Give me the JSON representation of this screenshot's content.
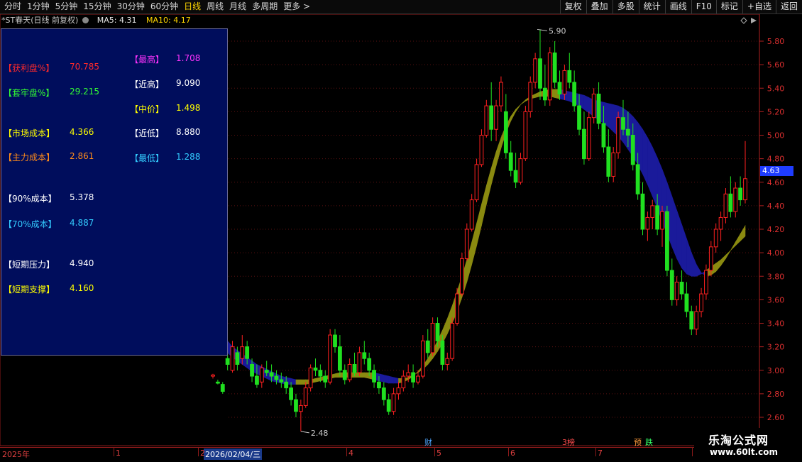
{
  "toolbar": {
    "periods": [
      "分时",
      "1分钟",
      "5分钟",
      "15分钟",
      "30分钟",
      "60分钟",
      "日线",
      "周线",
      "月线",
      "多周期",
      "更多 >"
    ],
    "active_period": "日线",
    "tools": [
      "复权",
      "叠加",
      "多股",
      "统计",
      "画线",
      "F10",
      "标记",
      "+自选",
      "返回"
    ]
  },
  "infobar": {
    "title": "*ST春天(日线 前复权)",
    "ma5": "MA5: 4.31",
    "ma10": "MA10: 4.17"
  },
  "panel": {
    "left": [
      {
        "label": "【获利盘%】",
        "value": "70.785",
        "color": "#ff2a2a"
      },
      {
        "label": "【套牢盘%】",
        "value": "29.215",
        "color": "#33ff33"
      },
      {
        "label": "【市场成本】",
        "value": "4.366",
        "color": "#ffff00"
      },
      {
        "label": "【主力成本】",
        "value": "2.861",
        "color": "#ff8c1a"
      },
      {
        "label": "【90%成本】",
        "value": "5.378",
        "color": "#ffffff"
      },
      {
        "label": "【70%成本】",
        "value": "4.887",
        "color": "#33ccff"
      },
      {
        "label": "【短期压力】",
        "value": "4.940",
        "color": "#ffffff"
      },
      {
        "label": "【短期支撑】",
        "value": "4.160",
        "color": "#ffff00"
      }
    ],
    "right": [
      {
        "label": "【最高】",
        "value": "1.708",
        "color": "#ff33ff"
      },
      {
        "label": "【近高】",
        "value": "9.090",
        "color": "#ffffff"
      },
      {
        "label": "【中价】",
        "value": "1.498",
        "color": "#ffff00"
      },
      {
        "label": "【近低】",
        "value": "8.880",
        "color": "#ffffff"
      },
      {
        "label": "【最低】",
        "value": "1.288",
        "color": "#33ccff"
      }
    ]
  },
  "price_axis": {
    "labels": [
      "5.80",
      "5.60",
      "5.40",
      "5.20",
      "5.00",
      "4.80",
      "4.60",
      "4.40",
      "4.20",
      "4.00",
      "3.80",
      "3.60",
      "3.40",
      "3.20",
      "3.00",
      "2.80",
      "2.60"
    ],
    "current": "4.63"
  },
  "annotations": {
    "high": "5.90",
    "low": "2.48"
  },
  "time_axis": {
    "year": "2025年",
    "cursor_date": "2026/02/04/三",
    "months": [
      "1",
      "2",
      "4",
      "5",
      "6",
      "7",
      "8"
    ]
  },
  "events": [
    {
      "text": "财",
      "color": "#4da6ff"
    },
    {
      "text": "3榜",
      "color": "#ff4d4d"
    },
    {
      "text": "预",
      "color": "#ff9a3a"
    },
    {
      "text": "跌",
      "color": "#33ff66"
    }
  ],
  "brand": {
    "name": "乐淘公式网",
    "url": "www.60lt.com"
  },
  "chart_data": {
    "type": "candlestick",
    "ylim": [
      2.5,
      5.95
    ],
    "candles": [
      [
        2.95,
        2.97,
        2.93,
        2.96
      ],
      [
        2.9,
        2.92,
        2.88,
        2.89
      ],
      [
        2.88,
        2.9,
        2.8,
        2.82
      ],
      [
        3.1,
        3.15,
        3.0,
        3.05
      ],
      [
        3.0,
        3.25,
        2.98,
        3.2
      ],
      [
        3.15,
        3.2,
        3.0,
        3.05
      ],
      [
        3.1,
        3.3,
        3.05,
        3.2
      ],
      [
        3.2,
        3.25,
        3.05,
        3.1
      ],
      [
        3.05,
        3.1,
        2.9,
        2.95
      ],
      [
        2.95,
        3.05,
        2.85,
        2.88
      ],
      [
        2.9,
        3.05,
        2.85,
        3.02
      ],
      [
        3.0,
        3.08,
        2.95,
        2.98
      ],
      [
        2.98,
        3.05,
        2.9,
        2.95
      ],
      [
        2.95,
        3.0,
        2.88,
        2.92
      ],
      [
        2.92,
        2.98,
        2.85,
        2.9
      ],
      [
        2.9,
        2.95,
        2.8,
        2.85
      ],
      [
        2.85,
        2.9,
        2.7,
        2.75
      ],
      [
        2.75,
        2.8,
        2.6,
        2.65
      ],
      [
        2.65,
        2.75,
        2.48,
        2.7
      ],
      [
        2.7,
        2.9,
        2.68,
        2.85
      ],
      [
        2.85,
        3.05,
        2.82,
        3.02
      ],
      [
        3.02,
        3.1,
        2.95,
        3.0
      ],
      [
        3.0,
        3.05,
        2.9,
        2.95
      ],
      [
        2.95,
        3.0,
        2.85,
        2.9
      ],
      [
        2.9,
        3.35,
        2.88,
        3.3
      ],
      [
        3.3,
        3.35,
        3.15,
        3.2
      ],
      [
        3.2,
        3.3,
        2.95,
        3.0
      ],
      [
        3.0,
        3.05,
        2.88,
        2.92
      ],
      [
        2.92,
        3.1,
        2.9,
        3.05
      ],
      [
        3.05,
        3.15,
        2.95,
        2.98
      ],
      [
        2.98,
        3.2,
        2.95,
        3.15
      ],
      [
        3.15,
        3.25,
        3.05,
        3.1
      ],
      [
        3.1,
        3.15,
        2.95,
        3.0
      ],
      [
        3.0,
        3.05,
        2.85,
        2.9
      ],
      [
        2.9,
        2.95,
        2.8,
        2.85
      ],
      [
        2.85,
        2.9,
        2.7,
        2.75
      ],
      [
        2.75,
        2.8,
        2.62,
        2.65
      ],
      [
        2.65,
        2.85,
        2.62,
        2.8
      ],
      [
        2.8,
        2.9,
        2.75,
        2.85
      ],
      [
        2.85,
        3.0,
        2.82,
        2.95
      ],
      [
        2.95,
        3.05,
        2.9,
        2.98
      ],
      [
        2.98,
        3.05,
        2.85,
        2.9
      ],
      [
        2.9,
        3.0,
        2.88,
        2.95
      ],
      [
        2.95,
        3.3,
        2.93,
        3.25
      ],
      [
        3.25,
        3.35,
        3.1,
        3.15
      ],
      [
        3.15,
        3.45,
        3.12,
        3.4
      ],
      [
        3.4,
        3.45,
        3.2,
        3.25
      ],
      [
        3.25,
        3.3,
        3.0,
        3.05
      ],
      [
        3.05,
        3.15,
        3.0,
        3.1
      ],
      [
        3.1,
        3.45,
        3.08,
        3.4
      ],
      [
        3.4,
        3.7,
        3.38,
        3.65
      ],
      [
        3.65,
        4.0,
        3.63,
        3.95
      ],
      [
        3.95,
        4.25,
        3.93,
        4.2
      ],
      [
        4.2,
        4.5,
        4.18,
        4.45
      ],
      [
        4.45,
        4.8,
        4.43,
        4.75
      ],
      [
        4.75,
        5.05,
        4.73,
        5.0
      ],
      [
        5.0,
        5.3,
        4.98,
        5.25
      ],
      [
        5.25,
        5.45,
        4.95,
        5.05
      ],
      [
        5.05,
        5.3,
        4.95,
        5.25
      ],
      [
        5.25,
        5.5,
        5.2,
        5.45
      ],
      [
        5.2,
        5.35,
        4.8,
        4.85
      ],
      [
        4.85,
        4.95,
        4.65,
        4.7
      ],
      [
        4.7,
        4.85,
        4.55,
        4.6
      ],
      [
        4.6,
        4.85,
        4.58,
        4.8
      ],
      [
        4.8,
        5.25,
        4.78,
        5.2
      ],
      [
        5.2,
        5.5,
        5.15,
        5.45
      ],
      [
        5.45,
        5.7,
        5.4,
        5.65
      ],
      [
        5.65,
        5.9,
        5.3,
        5.4
      ],
      [
        5.4,
        5.6,
        5.25,
        5.3
      ],
      [
        5.3,
        5.75,
        5.25,
        5.7
      ],
      [
        5.7,
        5.8,
        5.4,
        5.45
      ],
      [
        5.45,
        5.55,
        5.3,
        5.35
      ],
      [
        5.35,
        5.6,
        5.3,
        5.55
      ],
      [
        5.55,
        5.7,
        5.4,
        5.45
      ],
      [
        5.45,
        5.55,
        5.2,
        5.25
      ],
      [
        5.25,
        5.35,
        5.0,
        5.05
      ],
      [
        5.05,
        5.2,
        4.75,
        4.8
      ],
      [
        4.8,
        5.2,
        4.78,
        5.15
      ],
      [
        5.15,
        5.4,
        5.1,
        5.35
      ],
      [
        5.35,
        5.45,
        5.05,
        5.1
      ],
      [
        5.1,
        5.25,
        4.85,
        4.9
      ],
      [
        4.9,
        5.05,
        4.6,
        4.65
      ],
      [
        4.65,
        4.9,
        4.6,
        4.85
      ],
      [
        4.85,
        5.2,
        4.8,
        5.15
      ],
      [
        5.15,
        5.3,
        5.0,
        5.05
      ],
      [
        5.05,
        5.2,
        4.9,
        5.0
      ],
      [
        5.0,
        5.1,
        4.7,
        4.75
      ],
      [
        4.75,
        4.85,
        4.45,
        4.5
      ],
      [
        4.5,
        4.6,
        4.15,
        4.2
      ],
      [
        4.2,
        4.35,
        4.1,
        4.3
      ],
      [
        4.3,
        4.45,
        4.2,
        4.4
      ],
      [
        4.4,
        4.5,
        4.15,
        4.2
      ],
      [
        4.2,
        4.4,
        4.05,
        4.35
      ],
      [
        4.35,
        4.4,
        3.8,
        3.85
      ],
      [
        3.85,
        3.95,
        3.55,
        3.6
      ],
      [
        3.6,
        3.8,
        3.55,
        3.75
      ],
      [
        3.75,
        3.85,
        3.6,
        3.65
      ],
      [
        3.65,
        3.75,
        3.45,
        3.5
      ],
      [
        3.5,
        3.55,
        3.3,
        3.35
      ],
      [
        3.35,
        3.55,
        3.3,
        3.5
      ],
      [
        3.5,
        3.7,
        3.45,
        3.65
      ],
      [
        3.65,
        3.9,
        3.6,
        3.85
      ],
      [
        3.85,
        4.1,
        3.8,
        4.05
      ],
      [
        4.05,
        4.25,
        4.0,
        4.2
      ],
      [
        4.2,
        4.35,
        4.1,
        4.3
      ],
      [
        4.3,
        4.55,
        4.25,
        4.5
      ],
      [
        4.5,
        4.65,
        4.3,
        4.35
      ],
      [
        4.35,
        4.6,
        4.3,
        4.55
      ],
      [
        4.55,
        4.65,
        4.4,
        4.45
      ],
      [
        4.45,
        4.95,
        4.42,
        4.63
      ]
    ],
    "band_top": [
      3.4,
      3.35,
      3.3,
      3.25,
      3.2,
      3.17,
      3.14,
      3.11,
      3.08,
      3.05,
      3.03,
      3.01,
      2.99,
      2.97,
      2.95,
      2.94,
      2.93,
      2.92,
      2.92,
      2.92,
      2.92,
      2.93,
      2.94,
      2.95,
      2.96,
      2.97,
      2.98,
      2.98,
      2.98,
      2.98,
      2.98,
      2.98,
      2.98,
      2.98,
      2.97,
      2.96,
      2.95,
      2.94,
      2.93,
      2.93,
      2.94,
      2.96,
      2.98,
      3.01,
      3.05,
      3.1,
      3.16,
      3.23,
      3.31,
      3.4,
      3.5,
      3.62,
      3.75,
      3.9,
      4.06,
      4.23,
      4.41,
      4.58,
      4.74,
      4.89,
      5.02,
      5.12,
      5.2,
      5.26,
      5.3,
      5.33,
      5.35,
      5.37,
      5.38,
      5.39,
      5.39,
      5.39,
      5.38,
      5.37,
      5.36,
      5.35,
      5.34,
      5.32,
      5.3,
      5.29,
      5.28,
      5.27,
      5.26,
      5.25,
      5.23,
      5.2,
      5.16,
      5.11,
      5.05,
      4.98,
      4.9,
      4.81,
      4.71,
      4.6,
      4.48,
      4.36,
      4.24,
      4.12,
      4.0,
      3.9,
      3.83,
      3.8,
      3.81,
      3.84,
      3.89,
      3.95,
      4.02,
      4.09,
      4.16,
      4.23
    ],
    "band_bottom": [
      3.3,
      3.25,
      3.2,
      3.15,
      3.11,
      3.08,
      3.05,
      3.02,
      2.99,
      2.97,
      2.95,
      2.93,
      2.91,
      2.9,
      2.89,
      2.88,
      2.88,
      2.88,
      2.88,
      2.88,
      2.89,
      2.9,
      2.91,
      2.92,
      2.93,
      2.94,
      2.94,
      2.94,
      2.94,
      2.94,
      2.94,
      2.94,
      2.93,
      2.92,
      2.91,
      2.9,
      2.89,
      2.89,
      2.89,
      2.9,
      2.92,
      2.95,
      2.99,
      3.04,
      3.1,
      3.17,
      3.25,
      3.34,
      3.44,
      3.55,
      3.67,
      3.8,
      3.94,
      4.09,
      4.25,
      4.41,
      4.57,
      4.72,
      4.86,
      4.98,
      5.08,
      5.16,
      5.22,
      5.26,
      5.29,
      5.31,
      5.32,
      5.33,
      5.33,
      5.33,
      5.32,
      5.31,
      5.3,
      5.29,
      5.27,
      5.25,
      5.22,
      5.19,
      5.16,
      5.13,
      5.1,
      5.07,
      5.03,
      4.99,
      4.94,
      4.88,
      4.82,
      4.75,
      4.67,
      4.58,
      4.48,
      4.38,
      4.27,
      4.16,
      4.05,
      3.95,
      3.87,
      3.82,
      3.8,
      3.8,
      3.82,
      3.85,
      3.88,
      3.91,
      3.94,
      3.98,
      4.02,
      4.06,
      4.1,
      4.14
    ]
  }
}
